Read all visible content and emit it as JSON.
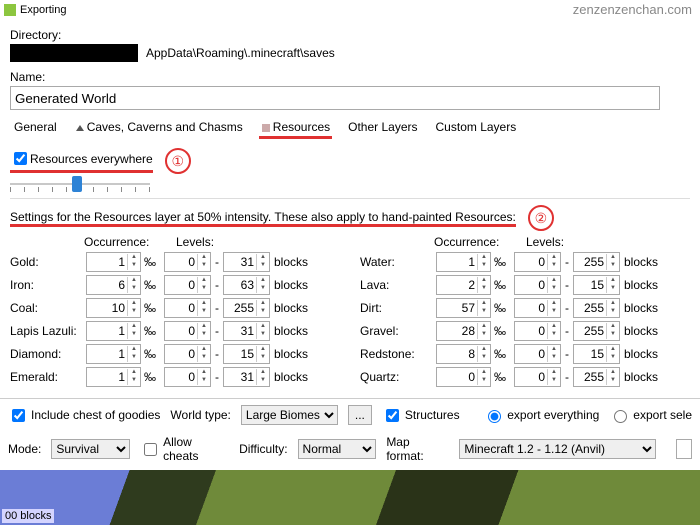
{
  "window_title": "Exporting",
  "watermark": "zenzenzenchan.com",
  "directory_label": "Directory:",
  "directory_path_rest": "AppData\\Roaming\\.minecraft\\saves",
  "name_label": "Name:",
  "name_value": "Generated World",
  "tabs": {
    "general": "General",
    "caves": "Caves, Caverns and Chasms",
    "resources": "Resources",
    "other": "Other Layers",
    "custom": "Custom Layers"
  },
  "res_everywhere": "Resources everywhere",
  "marker1": "①",
  "marker2": "②",
  "settings_text": "Settings for the Resources layer at 50% intensity. These also apply to hand-painted Resources:",
  "col_headers": {
    "occ": "Occurrence:",
    "lvl": "Levels:"
  },
  "permil": "‰",
  "blocks": "blocks",
  "dash": "-",
  "left": [
    {
      "name": "Gold:",
      "occ": "1",
      "lo": "0",
      "hi": "31"
    },
    {
      "name": "Iron:",
      "occ": "6",
      "lo": "0",
      "hi": "63"
    },
    {
      "name": "Coal:",
      "occ": "10",
      "lo": "0",
      "hi": "255"
    },
    {
      "name": "Lapis Lazuli:",
      "occ": "1",
      "lo": "0",
      "hi": "31"
    },
    {
      "name": "Diamond:",
      "occ": "1",
      "lo": "0",
      "hi": "15"
    },
    {
      "name": "Emerald:",
      "occ": "1",
      "lo": "0",
      "hi": "31"
    }
  ],
  "right": [
    {
      "name": "Water:",
      "occ": "1",
      "lo": "0",
      "hi": "255"
    },
    {
      "name": "Lava:",
      "occ": "2",
      "lo": "0",
      "hi": "15"
    },
    {
      "name": "Dirt:",
      "occ": "57",
      "lo": "0",
      "hi": "255"
    },
    {
      "name": "Gravel:",
      "occ": "28",
      "lo": "0",
      "hi": "255"
    },
    {
      "name": "Redstone:",
      "occ": "8",
      "lo": "0",
      "hi": "15"
    },
    {
      "name": "Quartz:",
      "occ": "0",
      "lo": "0",
      "hi": "255"
    }
  ],
  "bottom": {
    "chest": "Include chest of goodies",
    "world_type_label": "World type:",
    "world_type": "Large Biomes",
    "structures": "Structures",
    "export_all": "export everything",
    "export_sel": "export sele"
  },
  "line2": {
    "mode_label": "Mode:",
    "mode": "Survival",
    "cheats": "Allow cheats",
    "diff_label": "Difficulty:",
    "diff": "Normal",
    "format_label": "Map format:",
    "format": "Minecraft 1.2 - 1.12 (Anvil)"
  },
  "preview_tag": "00 blocks",
  "ellipsis": "..."
}
